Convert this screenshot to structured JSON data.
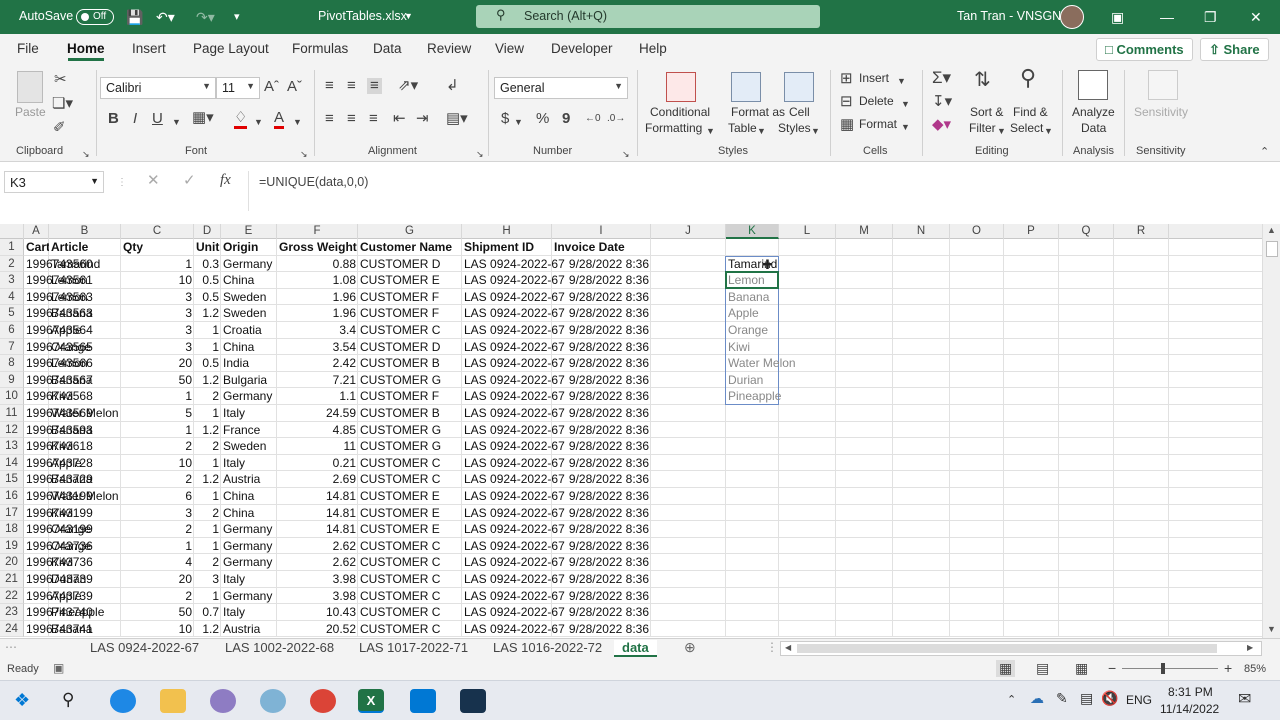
{
  "titlebar": {
    "autosave_label": "AutoSave",
    "autosave_state": "Off",
    "file_name": "PivotTables.xlsx",
    "search_placeholder": "Search (Alt+Q)",
    "user_name": "Tan Tran - VNSGN"
  },
  "ribbon_tabs": [
    "File",
    "Home",
    "Insert",
    "Page Layout",
    "Formulas",
    "Data",
    "Review",
    "View",
    "Developer",
    "Help"
  ],
  "active_tab": "Home",
  "top_buttons": {
    "comments": "Comments",
    "share": "Share"
  },
  "ribbon": {
    "clipboard": {
      "paste": "Paste",
      "label": "Clipboard"
    },
    "font": {
      "name": "Calibri",
      "size": "11",
      "label": "Font",
      "bold": "B",
      "italic": "I",
      "underline": "U"
    },
    "alignment": {
      "label": "Alignment"
    },
    "number": {
      "format": "General",
      "label": "Number",
      "currency": "$",
      "percent": "%",
      "comma": "9"
    },
    "styles": {
      "conditional_1": "Conditional",
      "conditional_2": "Formatting",
      "table_1": "Format as",
      "table_2": "Table",
      "cell_1": "Cell",
      "cell_2": "Styles",
      "label": "Styles"
    },
    "cells": {
      "insert": "Insert",
      "delete": "Delete",
      "format": "Format",
      "label": "Cells"
    },
    "editing": {
      "sort_1": "Sort &",
      "sort_2": "Filter",
      "find_1": "Find &",
      "find_2": "Select",
      "label": "Editing"
    },
    "analysis": {
      "analyze_1": "Analyze",
      "analyze_2": "Data",
      "label": "Analysis"
    },
    "sensitivity": {
      "btn": "Sensitivity",
      "label": "Sensitivity"
    }
  },
  "formula_bar": {
    "name_box": "K3",
    "formula": "=UNIQUE(data,0,0)",
    "fx": "fx"
  },
  "columns": [
    "A",
    "B",
    "C",
    "D",
    "E",
    "F",
    "G",
    "H",
    "I",
    "J",
    "K",
    "L",
    "M",
    "N",
    "O",
    "P",
    "Q",
    "R"
  ],
  "selected_column": "K",
  "headers": [
    "Carton ID",
    "Article",
    "Qty",
    "Unit Price",
    "Origin",
    "Gross Weight (Kgs)",
    "Customer Name",
    "Shipment ID",
    "Invoice Date"
  ],
  "rows": [
    [
      "1996743560",
      "Tamarind",
      "1",
      "0.3",
      "Germany",
      "0.88",
      "CUSTOMER D",
      "LAS 0924-2022-67",
      "9/28/2022 8:36"
    ],
    [
      "1996743561",
      "Lemon",
      "10",
      "0.5",
      "China",
      "1.08",
      "CUSTOMER E",
      "LAS 0924-2022-67",
      "9/28/2022 8:36"
    ],
    [
      "1996743563",
      "Lemon",
      "3",
      "0.5",
      "Sweden",
      "1.96",
      "CUSTOMER F",
      "LAS 0924-2022-67",
      "9/28/2022 8:36"
    ],
    [
      "1996743563",
      "Banana",
      "3",
      "1.2",
      "Sweden",
      "1.96",
      "CUSTOMER F",
      "LAS 0924-2022-67",
      "9/28/2022 8:36"
    ],
    [
      "1996743564",
      "Apple",
      "3",
      "1",
      "Croatia",
      "3.4",
      "CUSTOMER C",
      "LAS 0924-2022-67",
      "9/28/2022 8:36"
    ],
    [
      "1996743565",
      "Orange",
      "3",
      "1",
      "China",
      "3.54",
      "CUSTOMER D",
      "LAS 0924-2022-67",
      "9/28/2022 8:36"
    ],
    [
      "1996743566",
      "Lemon",
      "20",
      "0.5",
      "India",
      "2.42",
      "CUSTOMER B",
      "LAS 0924-2022-67",
      "9/28/2022 8:36"
    ],
    [
      "1996743567",
      "Banana",
      "50",
      "1.2",
      "Bulgaria",
      "7.21",
      "CUSTOMER G",
      "LAS 0924-2022-67",
      "9/28/2022 8:36"
    ],
    [
      "1996743568",
      "Kiwi",
      "1",
      "2",
      "Germany",
      "1.1",
      "CUSTOMER F",
      "LAS 0924-2022-67",
      "9/28/2022 8:36"
    ],
    [
      "1996743569",
      "Water Melon",
      "5",
      "1",
      "Italy",
      "24.59",
      "CUSTOMER B",
      "LAS 0924-2022-67",
      "9/28/2022 8:36"
    ],
    [
      "1996743593",
      "Banana",
      "1",
      "1.2",
      "France",
      "4.85",
      "CUSTOMER G",
      "LAS 0924-2022-67",
      "9/28/2022 8:36"
    ],
    [
      "1996743618",
      "Kiwi",
      "2",
      "2",
      "Sweden",
      "11",
      "CUSTOMER G",
      "LAS 0924-2022-67",
      "9/28/2022 8:36"
    ],
    [
      "1996743728",
      "Apple",
      "10",
      "1",
      "Italy",
      "0.21",
      "CUSTOMER C",
      "LAS 0924-2022-67",
      "9/28/2022 8:36"
    ],
    [
      "1996743729",
      "Banana",
      "2",
      "1.2",
      "Austria",
      "2.69",
      "CUSTOMER C",
      "LAS 0924-2022-67",
      "9/28/2022 8:36"
    ],
    [
      "1996743199",
      "Water Melon",
      "6",
      "1",
      "China",
      "14.81",
      "CUSTOMER E",
      "LAS 0924-2022-67",
      "9/28/2022 8:36"
    ],
    [
      "1996743199",
      "Kiwi",
      "3",
      "2",
      "China",
      "14.81",
      "CUSTOMER E",
      "LAS 0924-2022-67",
      "9/28/2022 8:36"
    ],
    [
      "1996743199",
      "Orange",
      "2",
      "1",
      "Germany",
      "14.81",
      "CUSTOMER E",
      "LAS 0924-2022-67",
      "9/28/2022 8:36"
    ],
    [
      "1996743736",
      "Orange",
      "1",
      "1",
      "Germany",
      "2.62",
      "CUSTOMER C",
      "LAS 0924-2022-67",
      "9/28/2022 8:36"
    ],
    [
      "1996743736",
      "Kiwi",
      "4",
      "2",
      "Germany",
      "2.62",
      "CUSTOMER C",
      "LAS 0924-2022-67",
      "9/28/2022 8:36"
    ],
    [
      "1996743739",
      "Durian",
      "20",
      "3",
      "Italy",
      "3.98",
      "CUSTOMER C",
      "LAS 0924-2022-67",
      "9/28/2022 8:36"
    ],
    [
      "1996743739",
      "Apple",
      "2",
      "1",
      "Germany",
      "3.98",
      "CUSTOMER C",
      "LAS 0924-2022-67",
      "9/28/2022 8:36"
    ],
    [
      "1996743740",
      "Pineapple",
      "50",
      "0.7",
      "Italy",
      "10.43",
      "CUSTOMER C",
      "LAS 0924-2022-67",
      "9/28/2022 8:36"
    ],
    [
      "1996743741",
      "Banana",
      "10",
      "1.2",
      "Austria",
      "20.52",
      "CUSTOMER C",
      "LAS 0924-2022-67",
      "9/28/2022 8:36"
    ]
  ],
  "unique_values": [
    "Tamarind",
    "Lemon",
    "Banana",
    "Apple",
    "Orange",
    "Kiwi",
    "Water Melon",
    "Durian",
    "Pineapple"
  ],
  "sheet_tabs": [
    "LAS 0924-2022-67",
    "LAS 1002-2022-68",
    "LAS 1017-2022-71",
    "LAS 1016-2022-72",
    "data"
  ],
  "active_sheet": "data",
  "status": {
    "ready": "Ready",
    "zoom": "85%"
  },
  "taskbar": {
    "time": "8:31 PM",
    "date": "11/14/2022",
    "lang": "ENG"
  },
  "colors": {
    "excel_green": "#217346",
    "spill_border": "#6b8cc7"
  }
}
